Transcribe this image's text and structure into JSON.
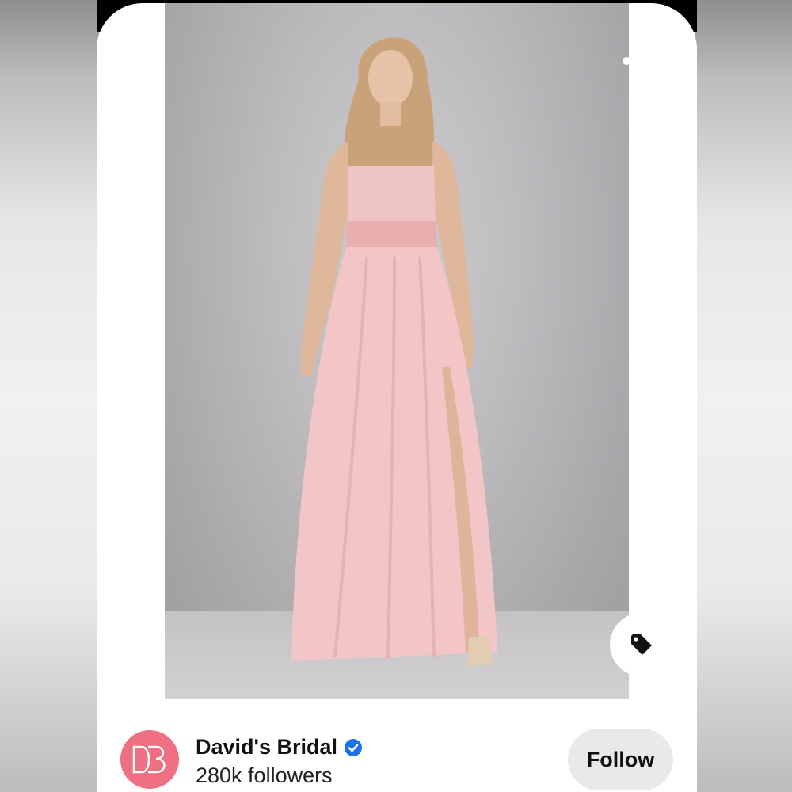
{
  "pin": {
    "image": "model-in-blush-pink-strapless-gown",
    "back_icon": "chevron-left-icon",
    "more_icon": "more-dots-icon",
    "tag_icon": "price-tag-icon"
  },
  "creator": {
    "logo_icon": "db-monogram-logo",
    "name": "David's Bridal",
    "verified_icon": "verified-badge-icon",
    "followers": "280k followers",
    "follow_label": "Follow"
  },
  "colors": {
    "logo_bg": "#ef6f83",
    "verified": "#1a73e8",
    "dress": "#f2c6c6"
  }
}
